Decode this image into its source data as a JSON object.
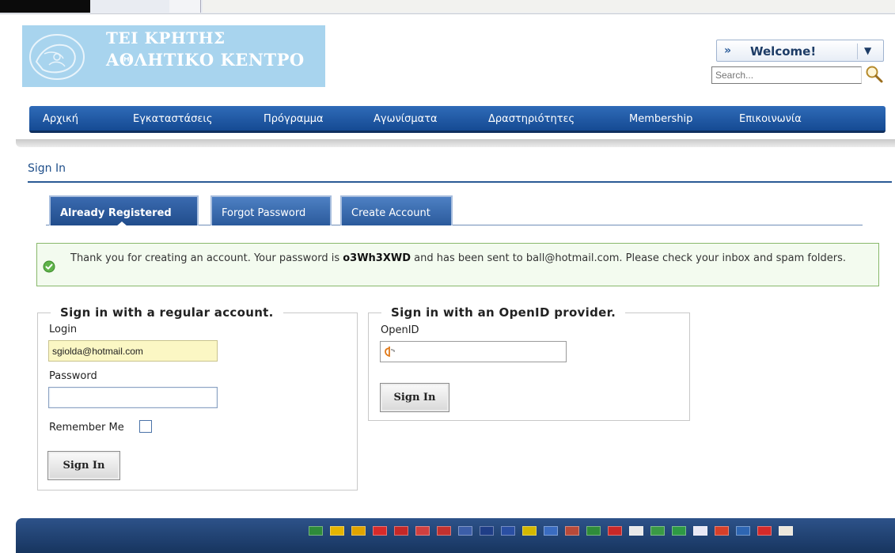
{
  "header": {
    "logo_line1": "ΤΕΙ ΚΡΗΤΗΣ",
    "logo_line2": "ΑΘΛΗΤΙΚΟ ΚΕΝΤΡΟ",
    "welcome": "Welcome!",
    "search_placeholder": "Search..."
  },
  "nav": {
    "items": [
      "Αρχική",
      "Εγκαταστάσεις",
      "Πρόγραμμα",
      "Αγωνίσματα",
      "Δραστηριότητες",
      "Membership",
      "Επικοινωνία"
    ]
  },
  "page": {
    "title": "Sign In"
  },
  "tabs": [
    {
      "label": "Already Registered",
      "active": true
    },
    {
      "label": "Forgot Password",
      "active": false
    },
    {
      "label": "Create Account",
      "active": false
    }
  ],
  "message": {
    "prefix": "Thank you for creating an account. Your password is ",
    "password": "o3Wh3XWD",
    "suffix": " and has been sent to ball@hotmail.com. Please check your inbox and spam folders."
  },
  "regular_signin": {
    "legend": "Sign in with a regular account.",
    "login_label": "Login",
    "login_value": "sgiolda@hotmail.com",
    "password_label": "Password",
    "remember_label": "Remember Me",
    "button": "Sign In"
  },
  "openid_signin": {
    "legend": "Sign in with an OpenID provider.",
    "openid_label": "OpenID",
    "button": "Sign In"
  },
  "footer": {
    "flag_icons": [
      "saudi-arabia-flag-icon",
      "belgium-flag-icon",
      "germany-alt-flag-icon",
      "china-flag-icon",
      "taiwan-flag-icon",
      "czech-flag-icon",
      "netherlands-flag-icon",
      "usa-flag-icon",
      "uk-flag-icon",
      "france-flag-icon",
      "germany-flag-icon",
      "greece-flag-icon",
      "hungary-flag-icon",
      "italy-flag-icon",
      "japan-flag-icon",
      "korea-flag-icon",
      "iran-flag-icon",
      "brazil-flag-icon",
      "russia-flag-icon",
      "spain-flag-icon",
      "sweden-flag-icon",
      "turkey-flag-icon",
      "vietnam-flag-icon"
    ],
    "flag_colors": [
      "#2e8b3a",
      "#e5b500",
      "#e0a400",
      "#d72b2b",
      "#c52828",
      "#d04040",
      "#c2312f",
      "#3c5ea8",
      "#1f3e87",
      "#2a4fa3",
      "#d4b800",
      "#3a6cc1",
      "#b84a3a",
      "#2f8c3a",
      "#c82828",
      "#e9e9e9",
      "#3a9a45",
      "#2e9a45",
      "#e8e8f5",
      "#d6402a",
      "#2e66b3",
      "#d42a2a",
      "#ece7dc"
    ]
  }
}
